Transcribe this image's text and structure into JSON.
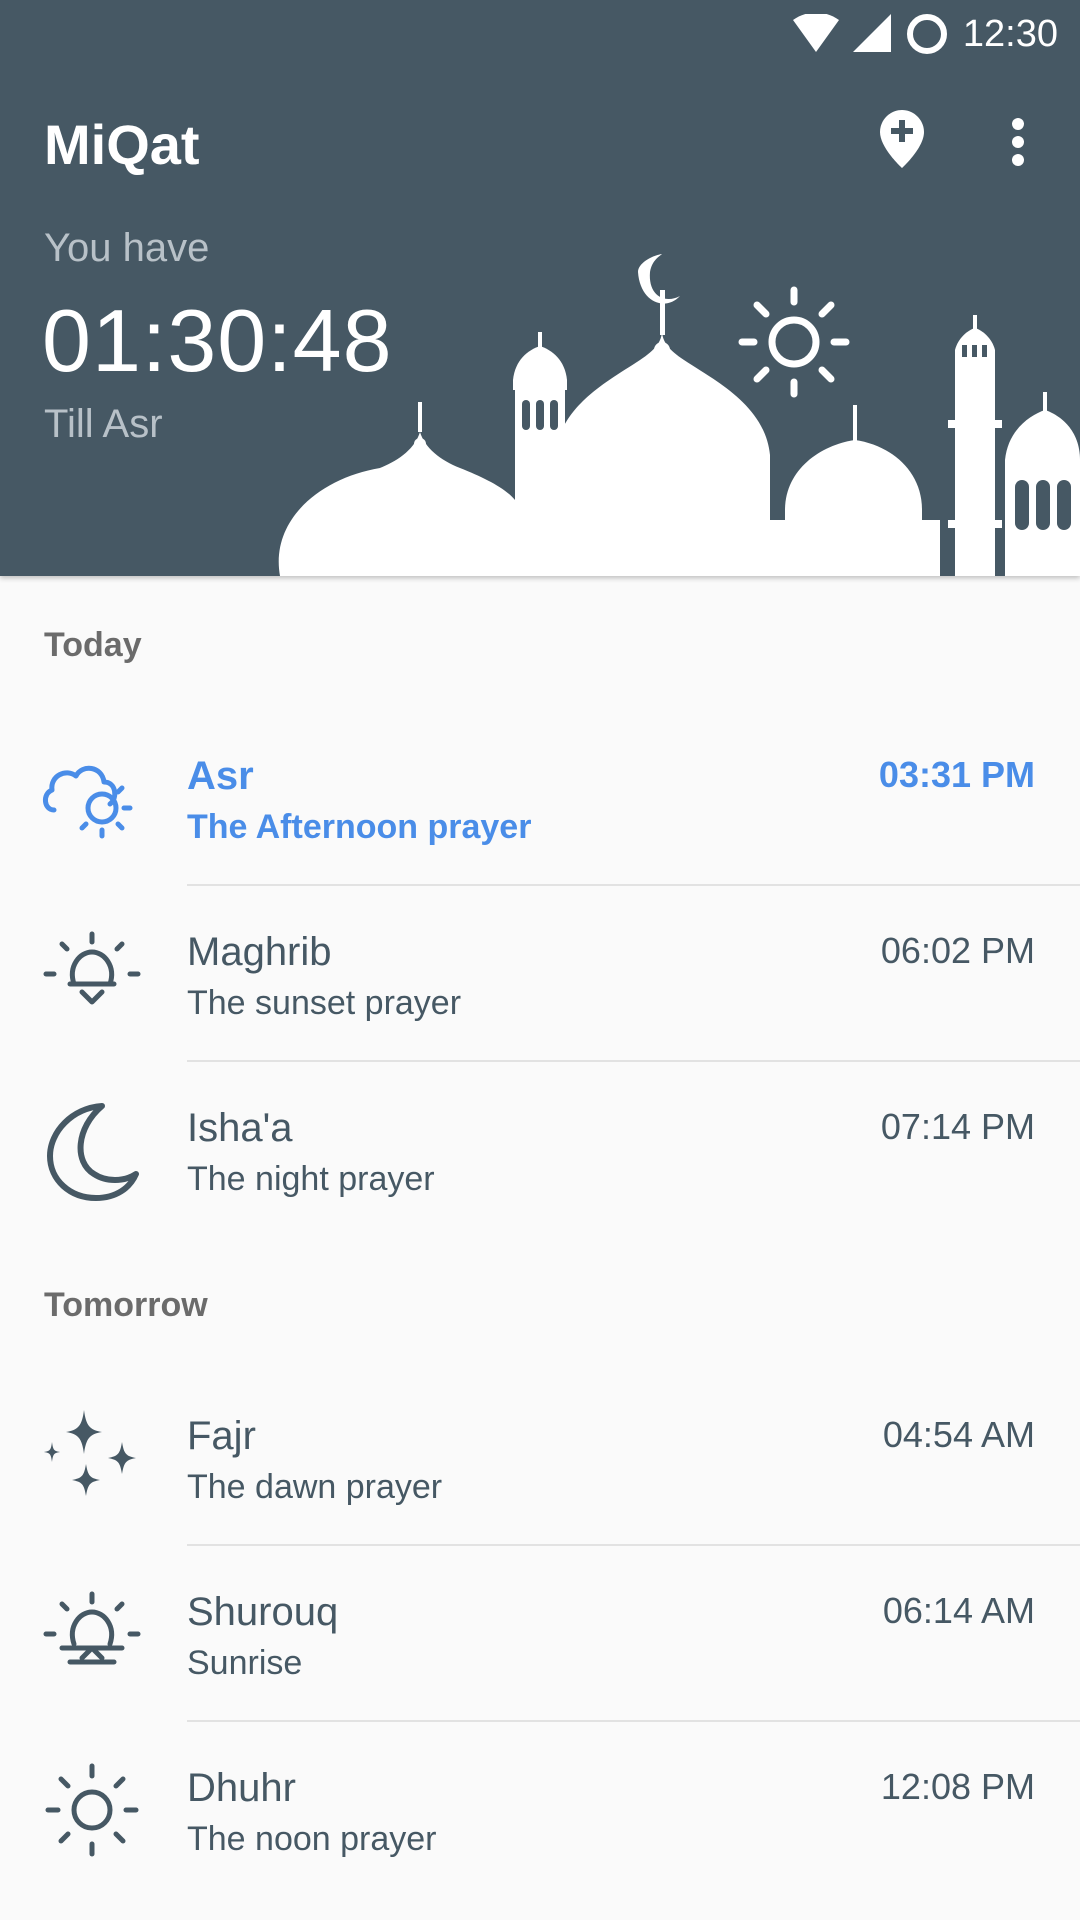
{
  "status_bar": {
    "time": "12:30"
  },
  "app": {
    "title": "MiQat"
  },
  "countdown": {
    "prefix": "You have",
    "value": "01:30:48",
    "suffix": "Till Asr"
  },
  "sections": [
    {
      "label": "Today",
      "prayers": [
        {
          "name": "Asr",
          "desc": "The Afternoon prayer",
          "time": "03:31 PM",
          "icon": "cloud-sun-icon",
          "active": true
        },
        {
          "name": "Maghrib",
          "desc": "The sunset prayer",
          "time": "06:02 PM",
          "icon": "sunset-icon",
          "active": false
        },
        {
          "name": "Isha'a",
          "desc": "The night prayer",
          "time": "07:14 PM",
          "icon": "moon-icon",
          "active": false
        }
      ]
    },
    {
      "label": "Tomorrow",
      "prayers": [
        {
          "name": "Fajr",
          "desc": "The dawn prayer",
          "time": "04:54 AM",
          "icon": "stars-icon",
          "active": false
        },
        {
          "name": "Shurouq",
          "desc": "Sunrise",
          "time": "06:14 AM",
          "icon": "sunrise-icon",
          "active": false
        },
        {
          "name": "Dhuhr",
          "desc": "The noon prayer",
          "time": "12:08 PM",
          "icon": "sun-icon",
          "active": false
        }
      ]
    }
  ],
  "colors": {
    "header": "#465864",
    "accent": "#4a8de8",
    "text": "#465864",
    "background": "#fafafa"
  }
}
